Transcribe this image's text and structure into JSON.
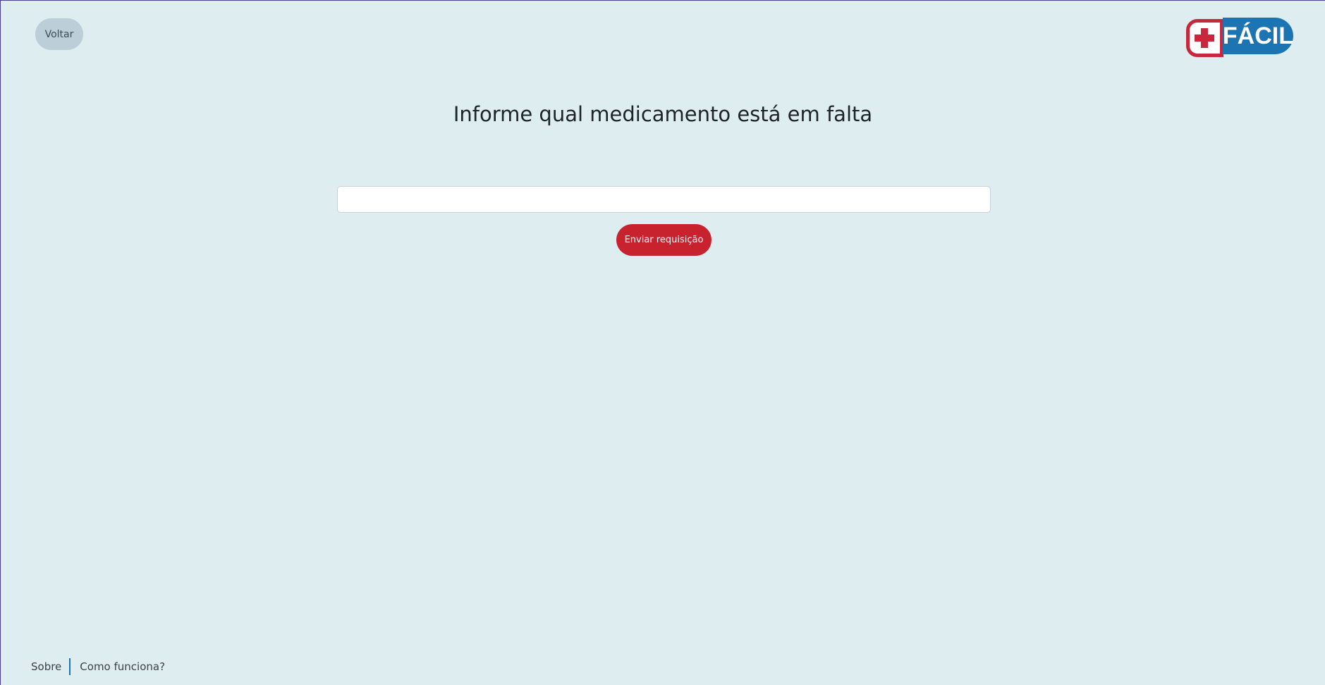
{
  "header": {
    "back_label": "Voltar",
    "logo": {
      "icon": "plus-icon",
      "text": "FÁCIL",
      "cross_color": "#c8283b",
      "word_bg": "#1d74b3"
    }
  },
  "main": {
    "title": "Informe qual medicamento está em falta",
    "input": {
      "value": "",
      "placeholder": ""
    },
    "submit_label": "Enviar requisição"
  },
  "footer": {
    "links": [
      {
        "label": "Sobre"
      },
      {
        "label": "Como funciona?"
      }
    ]
  },
  "colors": {
    "background": "#deeef0",
    "back_button": "#bccfd8",
    "submit_button": "#c8222f",
    "accent_blue": "#1d74b3"
  }
}
